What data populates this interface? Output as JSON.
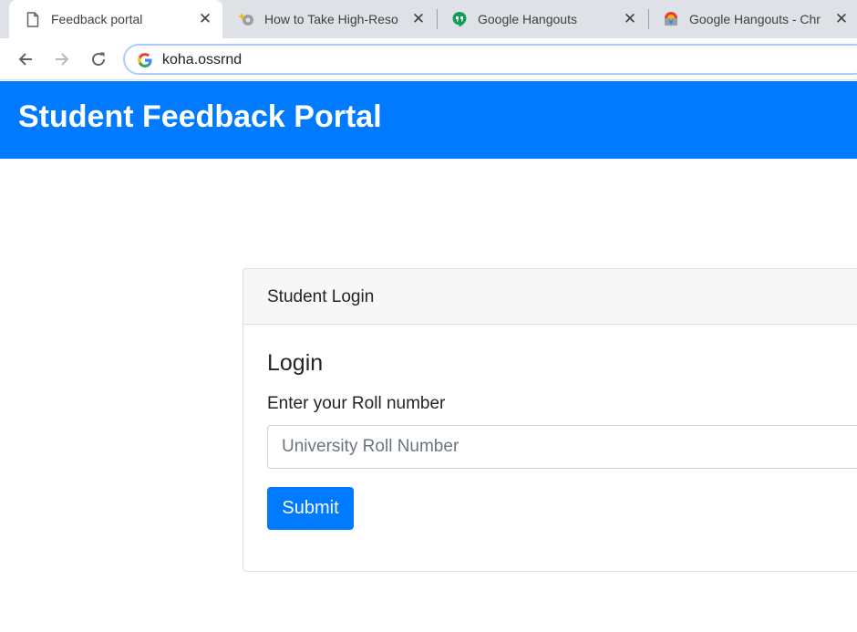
{
  "browser": {
    "tabs": [
      {
        "title": "Feedback portal",
        "active": true,
        "favicon": "document-icon"
      },
      {
        "title": "How to Take High-Reso",
        "active": false,
        "favicon": "magic-icon"
      },
      {
        "title": "Google Hangouts",
        "active": false,
        "favicon": "hangouts-icon"
      },
      {
        "title": "Google Hangouts - Chr",
        "active": false,
        "favicon": "chrome-webstore-icon"
      }
    ],
    "close_glyph": "✕",
    "url": "koha.ossrnd"
  },
  "header": {
    "title": "Student Feedback Portal",
    "color": "#007bff"
  },
  "login_card": {
    "header": "Student Login",
    "title": "Login",
    "roll_label": "Enter your Roll number",
    "roll_placeholder": "University Roll Number",
    "roll_value": "",
    "submit_label": "Submit"
  }
}
